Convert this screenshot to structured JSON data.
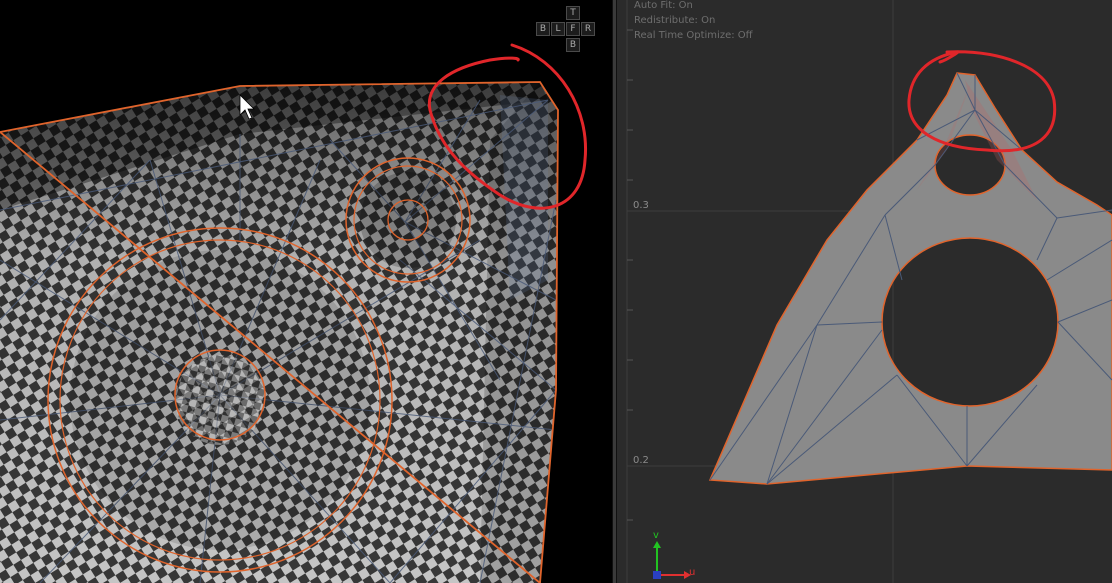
{
  "viewport3d": {
    "view_cube": {
      "top": "T",
      "back": "B",
      "left": "L",
      "front": "F",
      "right": "R",
      "bottom": "B"
    }
  },
  "uv_editor": {
    "options": {
      "auto_fit": "Auto Fit: On",
      "redistribute": "Redistribute: On",
      "realtime_optimize": "Real Time Optimize: Off"
    },
    "ticks": {
      "upper": "0.3",
      "lower": "0.2"
    },
    "axis": {
      "v_label": "v",
      "u_label": "u"
    }
  },
  "colors": {
    "seam": "#e0642c",
    "annotation": "#e0262a",
    "uv_axis_v": "#22c322",
    "uv_axis_u": "#e03030",
    "mesh_fill_uv": "#8a8a8a",
    "wireframe": "#4a5a78"
  }
}
